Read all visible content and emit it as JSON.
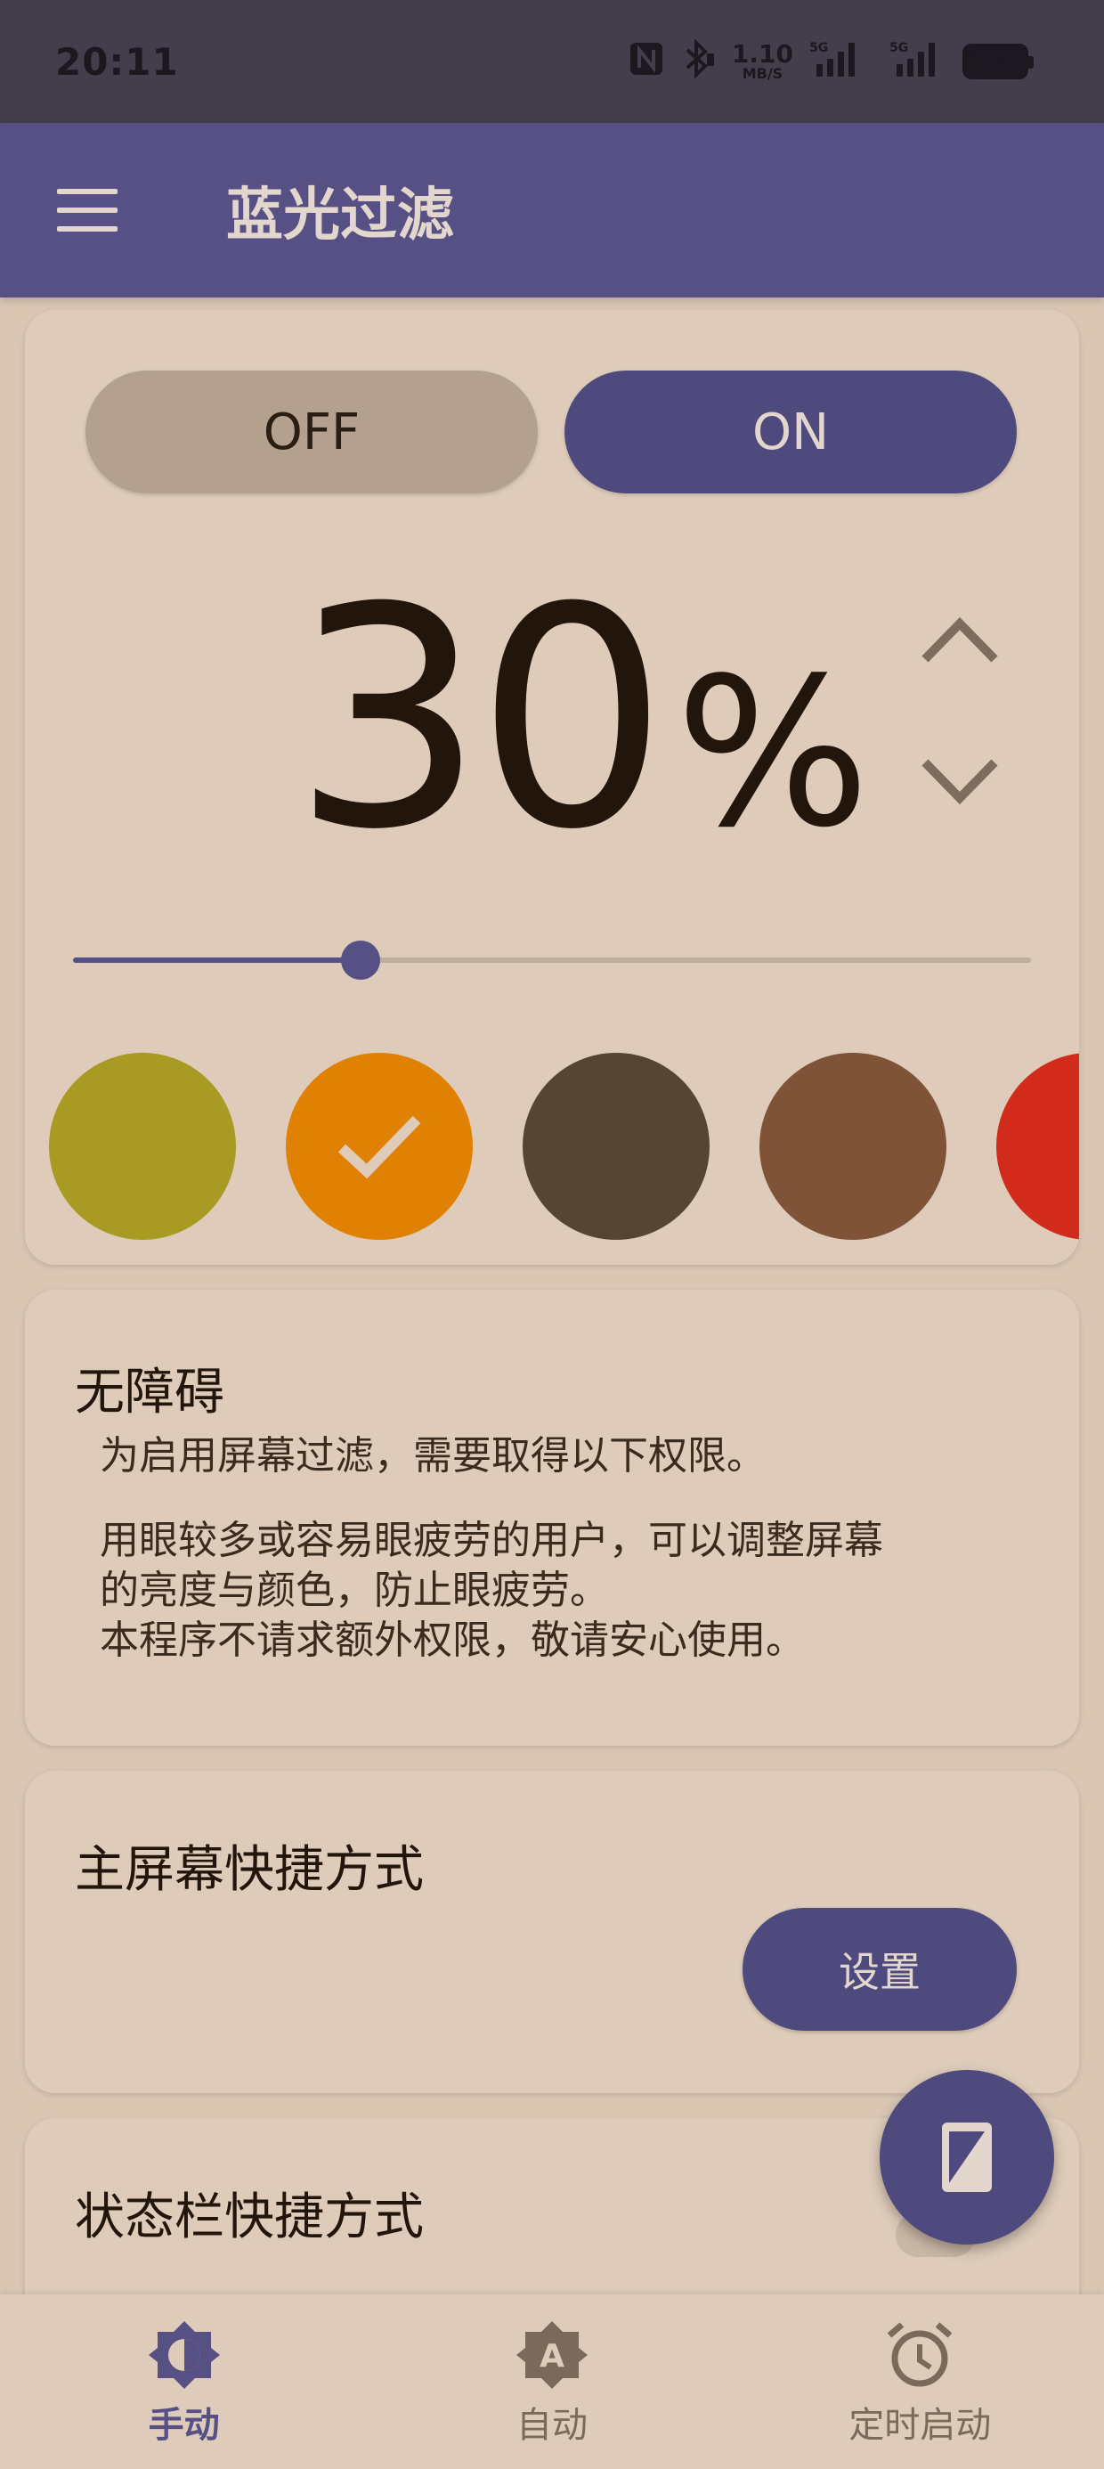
{
  "status_bar": {
    "time": "20:11",
    "speed_value": "1.10",
    "speed_unit": "MB/S",
    "signal1_label": "5G",
    "signal2_label": "5G",
    "battery": "100"
  },
  "app_bar": {
    "title": "蓝光过滤"
  },
  "filter": {
    "off_label": "OFF",
    "on_label": "ON",
    "active": "on",
    "percent_value": "30",
    "percent_sign": "%",
    "slider_level": 0.3,
    "swatches": [
      {
        "name": "olive",
        "color": "#a89a22",
        "selected": false
      },
      {
        "name": "orange",
        "color": "#e08104",
        "selected": true
      },
      {
        "name": "dark-brown",
        "color": "#574533",
        "selected": false
      },
      {
        "name": "brown",
        "color": "#7f5337",
        "selected": false
      },
      {
        "name": "red",
        "color": "#d22a1b",
        "selected": false
      }
    ]
  },
  "accessibility": {
    "title": "无障碍",
    "line1": "为启用屏幕过滤，需要取得以下权限。",
    "line2": "用眼较多或容易眼疲劳的用户，可以调整屏幕",
    "line3": "的亮度与颜色，防止眼疲劳。",
    "line4": "本程序不请求额外权限，敬请安心使用。"
  },
  "home_shortcut": {
    "title": "主屏幕快捷方式",
    "button_label": "设置"
  },
  "statusbar_shortcut": {
    "title": "状态栏快捷方式"
  },
  "bottom_nav": {
    "items": [
      {
        "label": "手动",
        "active": true
      },
      {
        "label": "自动",
        "active": false
      },
      {
        "label": "定时启动",
        "active": false
      }
    ]
  },
  "colors": {
    "accent": "#565085",
    "background": "#d9c6b3",
    "card": "#decbba"
  }
}
